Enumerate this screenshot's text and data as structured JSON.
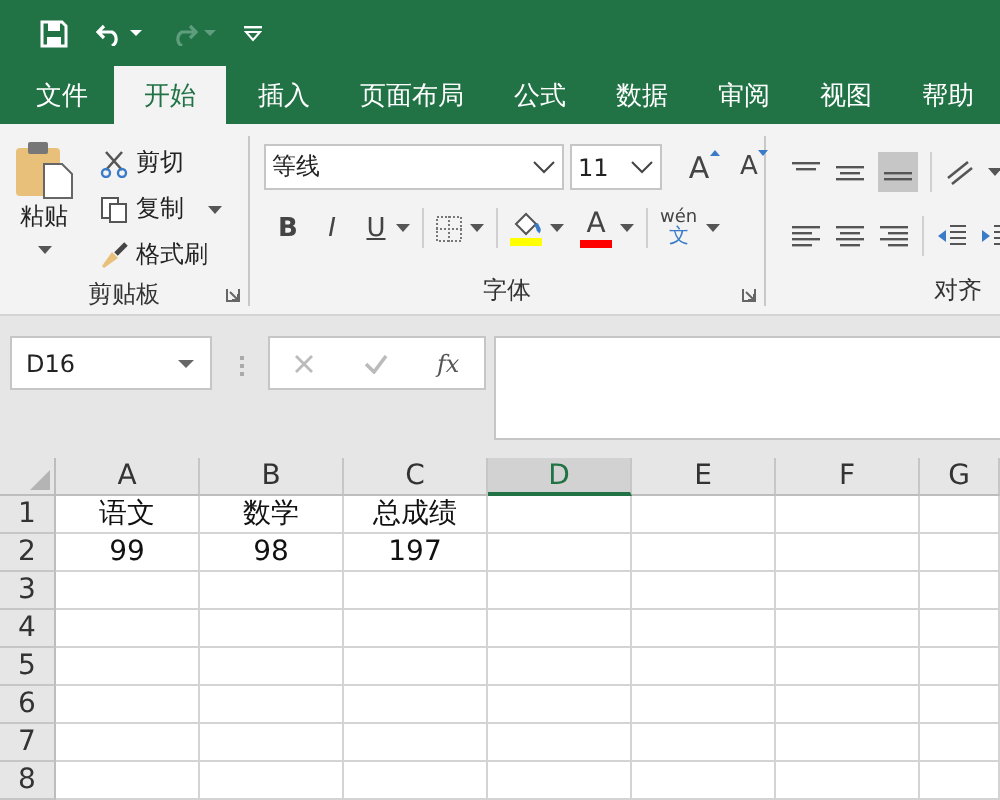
{
  "tabs": [
    {
      "label": "文件",
      "selected": false
    },
    {
      "label": "开始",
      "selected": true
    },
    {
      "label": "插入",
      "selected": false
    },
    {
      "label": "页面布局",
      "selected": false
    },
    {
      "label": "公式",
      "selected": false
    },
    {
      "label": "数据",
      "selected": false
    },
    {
      "label": "审阅",
      "selected": false
    },
    {
      "label": "视图",
      "selected": false
    },
    {
      "label": "帮助",
      "selected": false
    }
  ],
  "ribbon": {
    "clipboard": {
      "paste": "粘贴",
      "cut": "剪切",
      "copy": "复制",
      "format_painter": "格式刷",
      "label": "剪贴板"
    },
    "font": {
      "font_name": "等线",
      "font_size": "11",
      "grow": "A",
      "shrink": "A",
      "bold": "B",
      "italic": "I",
      "underline": "U",
      "font_color": "A",
      "phonetic_top": "wén",
      "phonetic_bottom": "文",
      "label": "字体"
    },
    "alignment": {
      "label": "对齐"
    }
  },
  "formula_bar": {
    "name_box": "D16",
    "function_label": "fx"
  },
  "sheet": {
    "columns": [
      {
        "label": "A",
        "selected": false
      },
      {
        "label": "B",
        "selected": false
      },
      {
        "label": "C",
        "selected": false
      },
      {
        "label": "D",
        "selected": true
      },
      {
        "label": "E",
        "selected": false
      },
      {
        "label": "F",
        "selected": false
      },
      {
        "label": "G",
        "selected": false
      }
    ],
    "rows": [
      {
        "label": "1",
        "cells": [
          "语文",
          "数学",
          "总成绩"
        ]
      },
      {
        "label": "2",
        "cells": [
          "99",
          "98",
          "197"
        ]
      },
      {
        "label": "3"
      },
      {
        "label": "4"
      },
      {
        "label": "5"
      },
      {
        "label": "6"
      },
      {
        "label": "7"
      },
      {
        "label": "8"
      }
    ]
  }
}
